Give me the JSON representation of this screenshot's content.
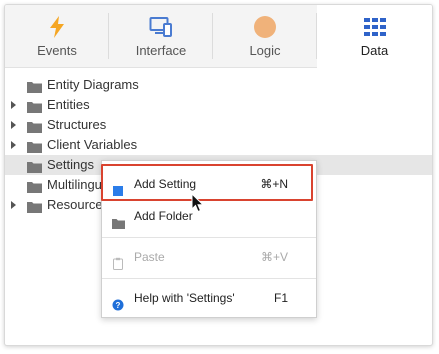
{
  "colors": {
    "events_icon": "#f5a623",
    "interface_icon": "#4a7bd1",
    "logic_icon": "#f0b27a",
    "data_icon": "#2f63c9",
    "folder": "#777777",
    "highlight": "#d9432f",
    "add_setting_icon": "#2b7de9",
    "help_icon": "#1f6fd9"
  },
  "tabs": [
    {
      "label": "Events",
      "icon": "lightning-icon"
    },
    {
      "label": "Interface",
      "icon": "monitor-icon"
    },
    {
      "label": "Logic",
      "icon": "circle-icon"
    },
    {
      "label": "Data",
      "icon": "grid-icon",
      "active": true
    }
  ],
  "tree": [
    {
      "label": "Entity Diagrams",
      "expandable": false
    },
    {
      "label": "Entities",
      "expandable": true
    },
    {
      "label": "Structures",
      "expandable": true
    },
    {
      "label": "Client Variables",
      "expandable": true
    },
    {
      "label": "Settings",
      "expandable": false,
      "selected": true
    },
    {
      "label": "Multilingual Locales",
      "expandable": false
    },
    {
      "label": "Resources",
      "expandable": true
    }
  ],
  "context_menu": {
    "items": [
      {
        "label": "Add Setting",
        "shortcut": "⌘+N",
        "icon": "square-icon",
        "highlighted": true
      },
      {
        "label": "Add Folder",
        "shortcut": "",
        "icon": "folder-icon"
      },
      {
        "label": "Paste",
        "shortcut": "⌘+V",
        "icon": "clipboard-icon",
        "disabled": true
      },
      {
        "label": "Help with 'Settings'",
        "shortcut": "F1",
        "icon": "help-icon"
      }
    ]
  }
}
